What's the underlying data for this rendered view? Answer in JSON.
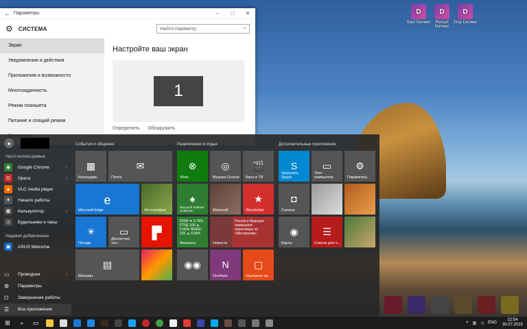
{
  "desktop": {
    "icons": [
      {
        "label": "Start Denwer",
        "color": "#8a3fb8"
      },
      {
        "label": "Restart Denwer",
        "color": "#b83f9a"
      },
      {
        "label": "Stop Denwer",
        "color": "#7a3fb0"
      }
    ]
  },
  "settings_window": {
    "title": "Параметры",
    "header": "СИСТЕМА",
    "search_placeholder": "Найти параметр",
    "nav": [
      "Экран",
      "Уведомления и действия",
      "Приложения и возможности",
      "Многозадачность",
      "Режим планшета",
      "Питание и спящий режим",
      "Хранилище"
    ],
    "active_nav": "Экран",
    "main_title": "Настройте ваш экран",
    "monitor_number": "1",
    "link_identify": "Определить",
    "link_detect": "Обнаружить"
  },
  "start_menu": {
    "most_used_caption": "Часто используемые",
    "most_used": [
      {
        "label": "Google Chrome",
        "arrow": true,
        "color": "#2e7d32"
      },
      {
        "label": "Opera",
        "arrow": true,
        "color": "#c62828"
      },
      {
        "label": "VLC media player",
        "arrow": false,
        "color": "#ef6c00"
      },
      {
        "label": "Начало работы",
        "arrow": false,
        "color": "#555"
      },
      {
        "label": "Калькулятор",
        "arrow": true,
        "color": "#444"
      },
      {
        "label": "Будильники и часы",
        "arrow": false,
        "color": "#444"
      }
    ],
    "recent_caption": "Недавно добавленные",
    "recent": [
      {
        "label": "ASUS Welcome",
        "color": "#1565c0"
      }
    ],
    "bottom": [
      {
        "label": "Проводник",
        "icon": "folder-icon",
        "arrow": true
      },
      {
        "label": "Параметры",
        "icon": "gear-icon",
        "arrow": false
      },
      {
        "label": "Завершение работы",
        "icon": "power-icon",
        "arrow": false
      },
      {
        "label": "Все приложения",
        "icon": "list-icon",
        "arrow": false
      }
    ],
    "groups": [
      "События и общения",
      "Развлечения и отдых",
      "Дополнительные приложения"
    ],
    "tiles": {
      "calendar": "Календарь",
      "mail": "Почта",
      "edge": "Microsoft Edge",
      "photos": "Фотографии",
      "weather": "Погода",
      "task_manager": "Диспетчер тел...",
      "store": "Магазин",
      "xbox": "Xbox",
      "groove": "Музыка Groove",
      "movies": "Кино и ТВ",
      "solitaire": "Microsoft Solitaire Collection",
      "minecraft": "Minecraft",
      "wunderlist": "Wunderlist",
      "finance_text": "DOW ▼ 0.78% FTSE 100 ▲ 0.40% NIKKEI 225 ▲ 0.99%",
      "finance": "Финансы",
      "news_text": "Россия и Франция завершили переговоры по «Мистралям»",
      "news": "Новости",
      "onenote": "OneNote",
      "office": "Улучшите св...",
      "skype": "Загрузить Skype",
      "this_pc": "Этот компьютер",
      "settings": "Параметры",
      "camera": "Camera",
      "maps": "Карты",
      "reading_list": "Список для ч..."
    }
  },
  "taskbar": {
    "lang": "ENG",
    "time": "22:54",
    "date": "30.07.2015"
  }
}
